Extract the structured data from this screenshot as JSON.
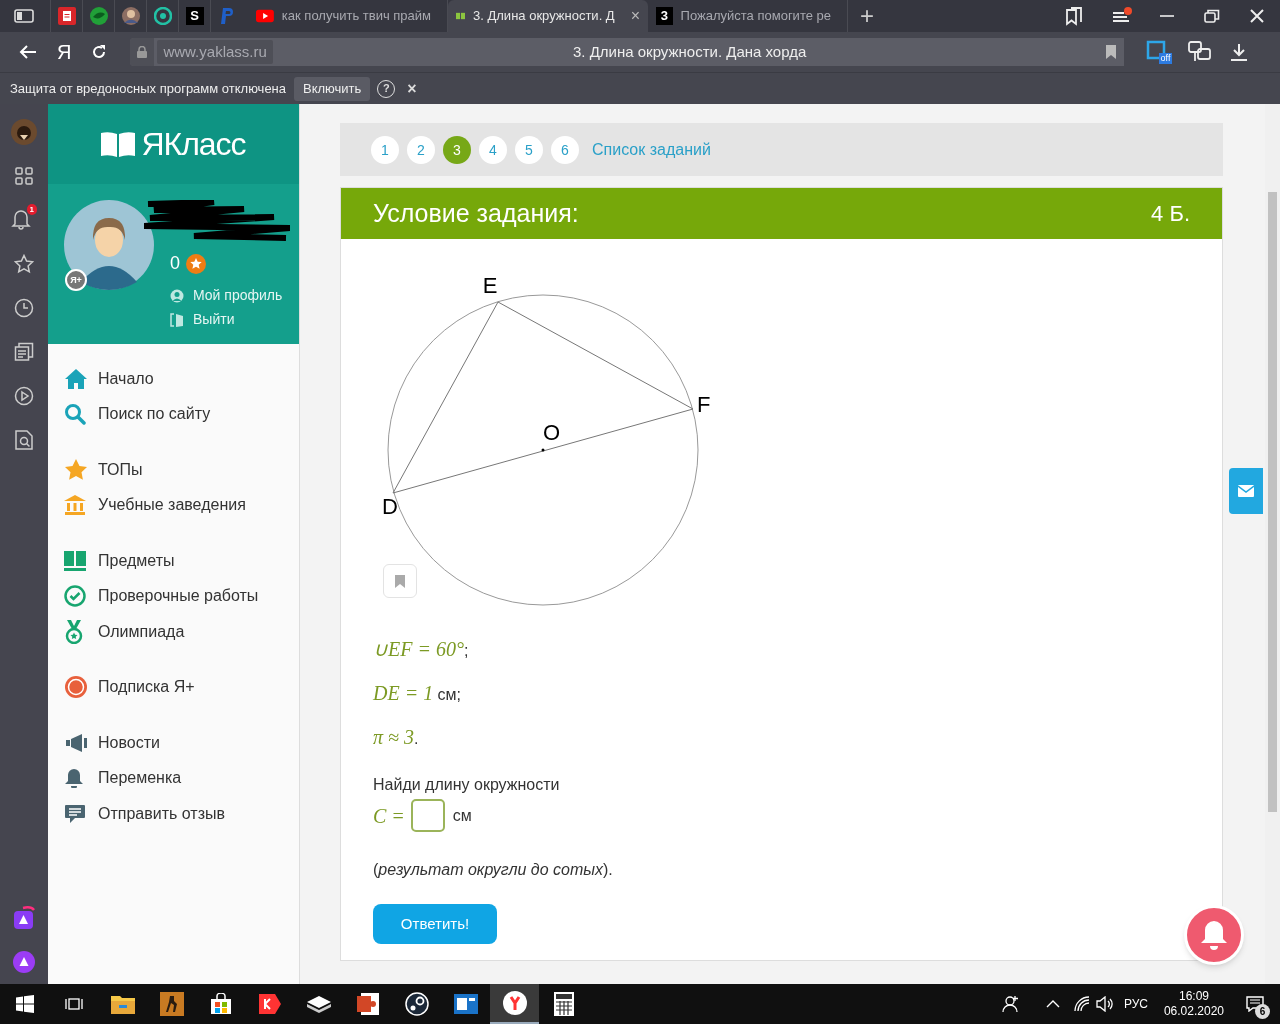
{
  "browser": {
    "pinned_tabs": [
      {
        "kind": "doc"
      },
      {
        "kind": "leaf"
      },
      {
        "kind": "avatar"
      },
      {
        "kind": "ring"
      },
      {
        "kind": "letter",
        "glyph": "S"
      },
      {
        "kind": "paypal"
      }
    ],
    "tabs": [
      {
        "title": "как получить твич прайм",
        "selected": false,
        "kind": "video"
      },
      {
        "title": "3. Длина окружности. Д",
        "selected": true,
        "kind": "book",
        "close": "×"
      },
      {
        "title": "Пожалуйста помогите ре",
        "selected": false,
        "kind": "letter",
        "glyph": "3"
      }
    ],
    "new_tab": "+",
    "home_logo": "Я",
    "url": "www.yaklass.ru",
    "page_title": "3. Длина окружности. Дана хорда",
    "extension_badge": "off",
    "protection_bar": {
      "message": "Защита от вредоносных программ отключена",
      "button": "Включить",
      "help": "?",
      "close": "×"
    }
  },
  "rail": {
    "notification_count": "1"
  },
  "site": {
    "logo": "ЯКласс",
    "profile": {
      "points": "0",
      "links": [
        "Мой профиль",
        "Выйти"
      ],
      "badge": "Я+"
    },
    "menu": [
      [
        {
          "label": "Начало"
        },
        {
          "label": "Поиск по сайту"
        }
      ],
      [
        {
          "label": "ТОПы"
        },
        {
          "label": "Учебные заведения"
        }
      ],
      [
        {
          "label": "Предметы"
        },
        {
          "label": "Проверочные работы"
        },
        {
          "label": "Олимпиада"
        }
      ],
      [
        {
          "label": "Подписка Я+"
        }
      ],
      [
        {
          "label": "Новости"
        },
        {
          "label": "Переменка"
        },
        {
          "label": "Отправить отзыв"
        }
      ]
    ]
  },
  "task": {
    "pager": [
      {
        "label": "1",
        "selected": false
      },
      {
        "label": "2",
        "selected": false
      },
      {
        "label": "3",
        "selected": true
      },
      {
        "label": "4",
        "selected": false
      },
      {
        "label": "5",
        "selected": false
      },
      {
        "label": "6",
        "selected": false
      }
    ],
    "task_list_link": "Список заданий",
    "heading": "Условие задания:",
    "points": "4 Б.",
    "diagram": {
      "points": [
        "E",
        "F",
        "O",
        "D"
      ]
    },
    "givens": [
      {
        "math": "∪EF = 60°",
        "suffix": ";"
      },
      {
        "math": "DE = 1",
        "suffix": " см;"
      },
      {
        "math": "π ≈ 3",
        "suffix": "."
      }
    ],
    "question": "Найди длину окружности",
    "answer": {
      "math": "C =",
      "unit": "см"
    },
    "note": "(*результат округли до сотых*).",
    "submit": "Ответить!"
  },
  "taskbar": {
    "language": "РУС",
    "time": "16:09",
    "date": "06.02.2020",
    "notifications": "6"
  }
}
